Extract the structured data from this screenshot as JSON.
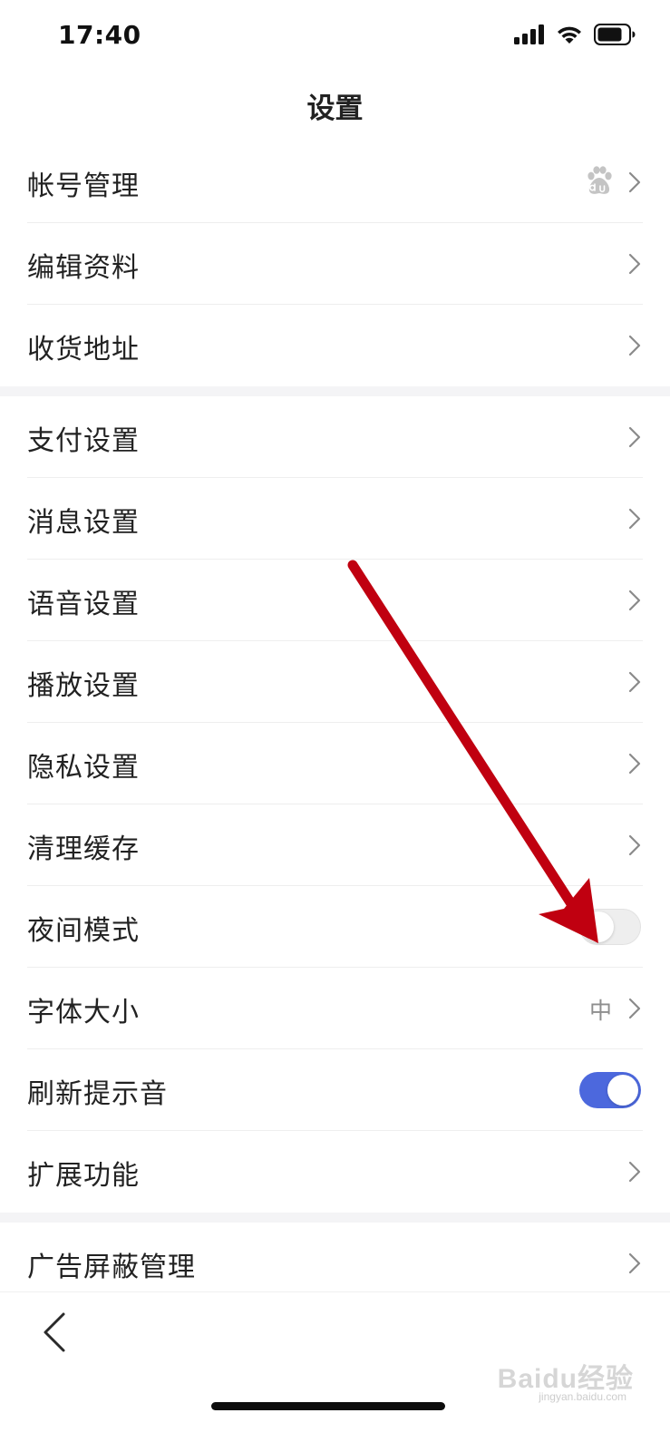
{
  "status_bar": {
    "time": "17:40"
  },
  "nav": {
    "title": "设置"
  },
  "groups": [
    {
      "rows": [
        {
          "label": "帐号管理",
          "accessory": "chevron",
          "badge_icon": "baidu-paw-icon"
        },
        {
          "label": "编辑资料",
          "accessory": "chevron"
        },
        {
          "label": "收货地址",
          "accessory": "chevron"
        }
      ]
    },
    {
      "rows": [
        {
          "label": "支付设置",
          "accessory": "chevron"
        },
        {
          "label": "消息设置",
          "accessory": "chevron"
        },
        {
          "label": "语音设置",
          "accessory": "chevron"
        },
        {
          "label": "播放设置",
          "accessory": "chevron"
        },
        {
          "label": "隐私设置",
          "accessory": "chevron"
        },
        {
          "label": "清理缓存",
          "accessory": "chevron"
        },
        {
          "label": "夜间模式",
          "accessory": "toggle",
          "toggle_on": false
        },
        {
          "label": "字体大小",
          "accessory": "chevron",
          "value": "中"
        },
        {
          "label": "刷新提示音",
          "accessory": "toggle",
          "toggle_on": true
        },
        {
          "label": "扩展功能",
          "accessory": "chevron"
        }
      ]
    },
    {
      "rows": [
        {
          "label": "广告屏蔽管理",
          "accessory": "chevron"
        }
      ]
    }
  ],
  "bottom_bar": {
    "back_icon": "back-chevron-icon"
  },
  "watermark": {
    "text": "Baidu经验",
    "sub": "jingyan.baidu.com"
  },
  "colors": {
    "toggle_on": "#4c68dd",
    "toggle_off": "#eeeeee",
    "annotation_arrow": "#c00010",
    "separator": "#eeeeee"
  }
}
